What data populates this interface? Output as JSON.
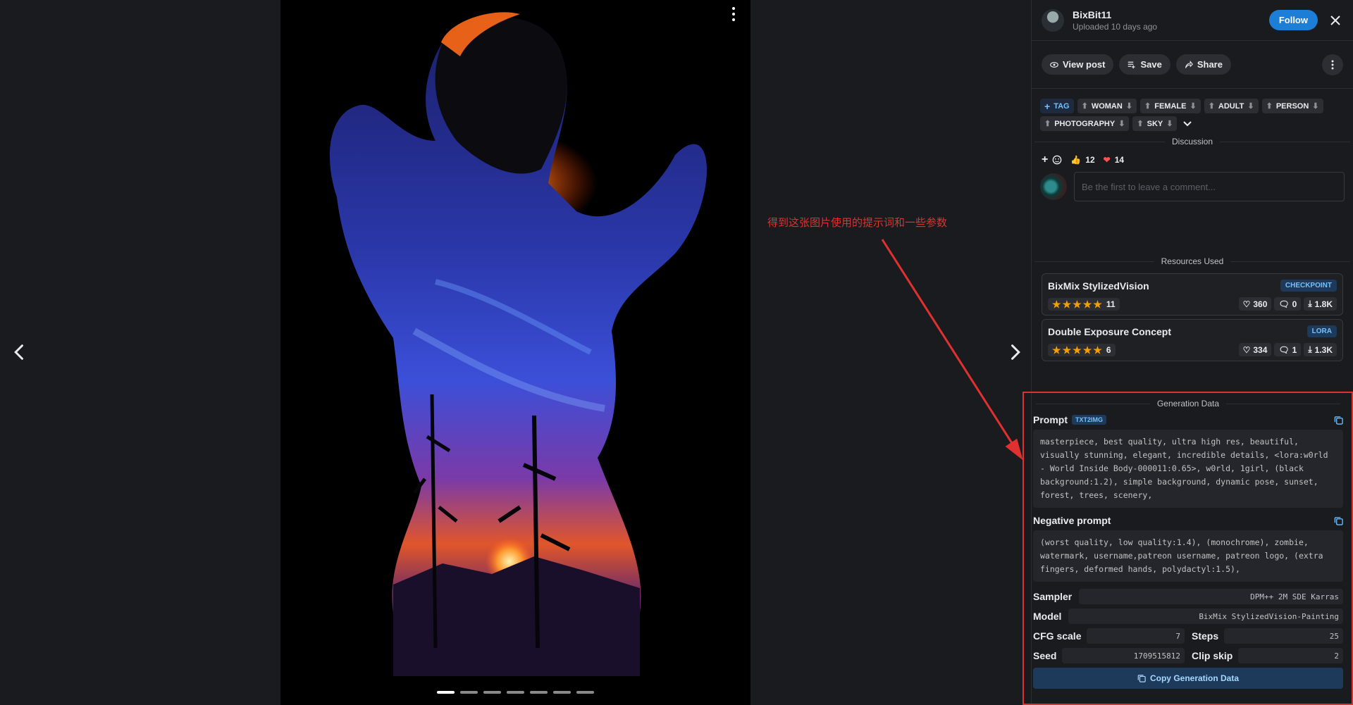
{
  "annotation_text": "得到这张图片使用的提示词和一些参数",
  "user": {
    "name": "BixBit11",
    "uploaded": "Uploaded 10 days ago",
    "follow": "Follow"
  },
  "actions": {
    "view_post": "View post",
    "save": "Save",
    "share": "Share"
  },
  "tags": {
    "add": "TAG",
    "items": [
      "WOMAN",
      "FEMALE",
      "ADULT",
      "PERSON",
      "PHOTOGRAPHY",
      "SKY"
    ]
  },
  "discussion": {
    "title": "Discussion",
    "likes": "12",
    "hearts": "14",
    "placeholder": "Be the first to leave a comment..."
  },
  "resources": {
    "title": "Resources Used",
    "items": [
      {
        "name": "BixMix StylizedVision",
        "type": "CHECKPOINT",
        "rating": "11",
        "likes": "360",
        "comments": "0",
        "downloads": "1.8K"
      },
      {
        "name": "Double Exposure Concept",
        "type": "LORA",
        "rating": "6",
        "likes": "334",
        "comments": "1",
        "downloads": "1.3K"
      }
    ]
  },
  "generation": {
    "title": "Generation Data",
    "prompt_label": "Prompt",
    "prompt_badge": "TXT2IMG",
    "prompt": "masterpiece, best quality, ultra high res, beautiful, visually stunning, elegant, incredible details, <lora:w0rld - World Inside Body-000011:0.65>, w0rld, 1girl, (black background:1.2), simple background, dynamic pose, sunset, forest, trees, scenery,",
    "negative_label": "Negative prompt",
    "negative": "(worst quality, low quality:1.4), (monochrome), zombie, watermark, username,patreon username, patreon logo, (extra fingers, deformed hands, polydactyl:1.5),",
    "sampler_label": "Sampler",
    "sampler": "DPM++ 2M SDE Karras",
    "model_label": "Model",
    "model": "BixMix StylizedVision-Painting",
    "cfg_label": "CFG scale",
    "cfg": "7",
    "steps_label": "Steps",
    "steps": "25",
    "seed_label": "Seed",
    "seed": "1709515812",
    "clip_label": "Clip skip",
    "clip": "2",
    "copy_button": "Copy Generation Data"
  },
  "colors": {
    "accent": "#1c7ed6",
    "annotation": "#e03131",
    "star": "#f59f00",
    "heart": "#fa5252"
  }
}
